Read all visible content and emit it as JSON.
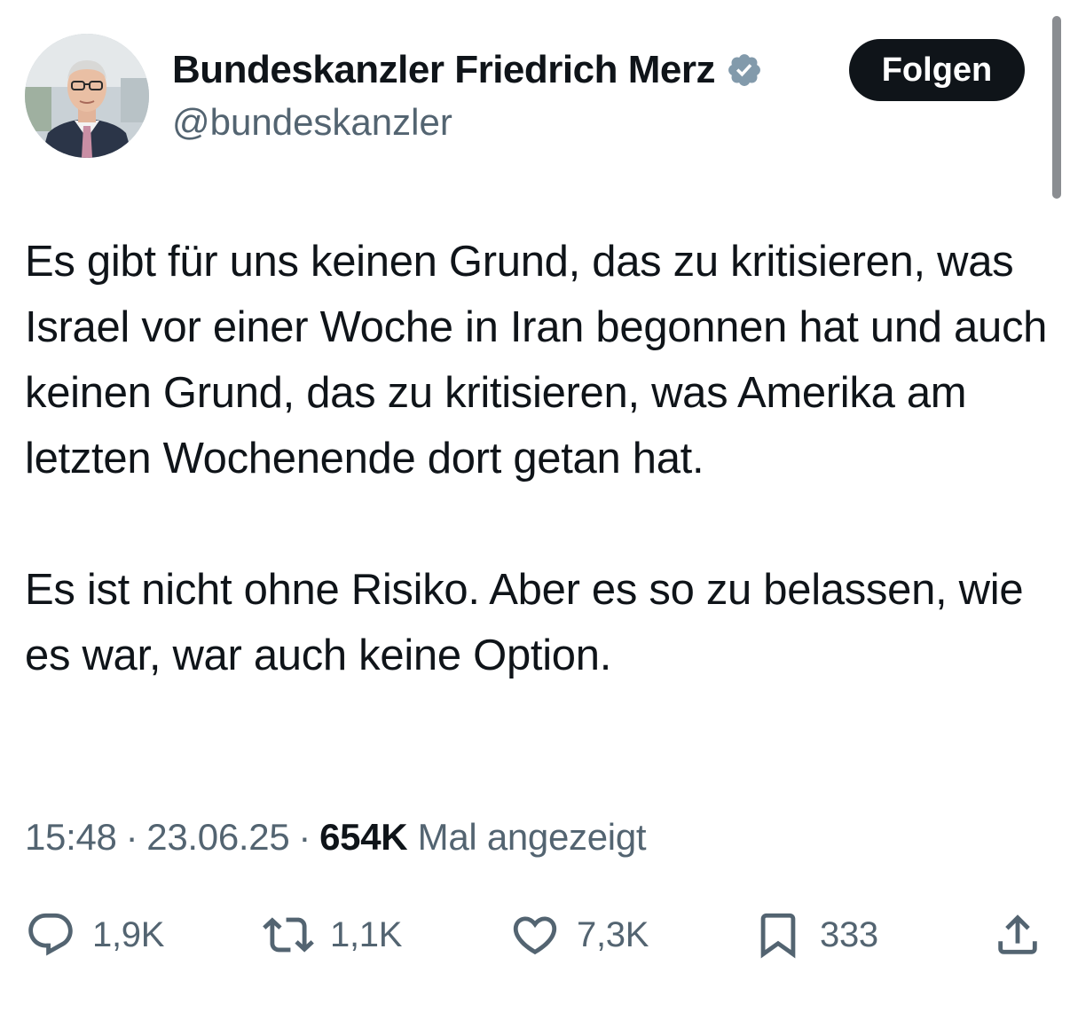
{
  "author": {
    "display_name": "Bundeskanzler Friedrich Merz",
    "handle": "@bundeskanzler",
    "verified_icon": "verified-badge-icon",
    "avatar_icon": "profile-photo"
  },
  "follow_button": {
    "label": "Folgen"
  },
  "tweet": {
    "paragraphs": [
      "Es gibt für uns keinen Grund, das zu kritisieren, was Israel vor einer Woche in Iran begonnen hat und auch keinen Grund, das zu kritisieren, was Amerika am letzten Wochenende dort getan hat.",
      "Es ist nicht ohne Risiko. Aber es so zu belassen, wie es war, war auch keine Option."
    ]
  },
  "meta": {
    "time": "15:48",
    "separator": "·",
    "date": "23.06.25",
    "views_count": "654K",
    "views_label": "Mal angezeigt"
  },
  "actions": {
    "replies": "1,9K",
    "reposts": "1,1K",
    "likes": "7,3K",
    "bookmarks": "333"
  },
  "colors": {
    "text_primary": "#0f1419",
    "text_secondary": "#536471",
    "verified_badge": "#829aab",
    "follow_button_bg": "#0f1419",
    "follow_button_text": "#ffffff"
  }
}
